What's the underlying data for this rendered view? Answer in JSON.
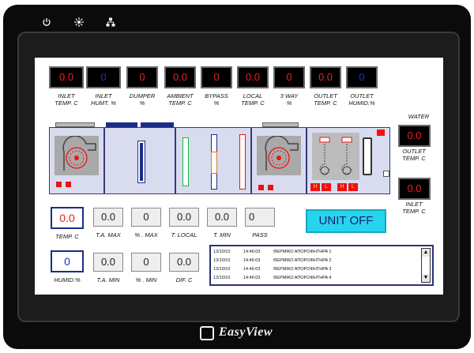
{
  "device": {
    "brand": "EasyView",
    "top_icons": [
      "power-icon",
      "brightness-icon",
      "network-icon"
    ]
  },
  "readouts": [
    {
      "value": "0.0",
      "label": "INLET\nTEMP. C",
      "color": "red"
    },
    {
      "value": "0",
      "label": "INLET\nHUMT. %",
      "color": "blue"
    },
    {
      "value": "0",
      "label": "DUMPER\n%",
      "color": "red"
    },
    {
      "value": "0.0",
      "label": "AMBIENT\nTEMP. C",
      "color": "red"
    },
    {
      "value": "0",
      "label": "BYPASS\n%",
      "color": "red"
    },
    {
      "value": "0.0",
      "label": "LOCAL\nTEMP. C",
      "color": "red"
    },
    {
      "value": "0",
      "label": "3 WAY\n%",
      "color": "red"
    },
    {
      "value": "0.0",
      "label": "OUTLET\nTEMP. C",
      "color": "red"
    },
    {
      "value": "0",
      "label": "OUTLET\nHUMID.%",
      "color": "blue"
    }
  ],
  "water": {
    "title": "WATER",
    "outlet": {
      "value": "0.0",
      "label": "OUTLET\nTEMP. C"
    },
    "inlet": {
      "value": "0.0",
      "label": "INLET\nTEMP. C"
    }
  },
  "ahu": {
    "heater_labels": [
      "H",
      "L",
      "H",
      "L"
    ]
  },
  "setpoints": {
    "temp": {
      "value": "0.0",
      "label": "TEMP. C"
    },
    "humid": {
      "value": "0",
      "label": "HUMID.%"
    },
    "row1": [
      {
        "value": "0.0",
        "label": "T.A. MAX"
      },
      {
        "value": "0",
        "label": "% . MAX"
      },
      {
        "value": "0.0",
        "label": "T. LOCAL"
      },
      {
        "value": "0.0",
        "label": "T. MIN"
      },
      {
        "value": "0",
        "label": "PASS"
      }
    ],
    "row2": [
      {
        "value": "0.0",
        "label": "T.A. MIN"
      },
      {
        "value": "0",
        "label": "% . MIN"
      },
      {
        "value": "0.0",
        "label": "DIF. C"
      }
    ]
  },
  "unit_button": {
    "label": "UNIT OFF",
    "color": "#27d4ee"
  },
  "alarms": [
    {
      "date": "13/10/10",
      "time": "14:46:03",
      "message": "ΘΕΡΜΙΚΟ ΑΠΟΡΟΦΗΤΗΡΑ 1"
    },
    {
      "date": "13/10/10",
      "time": "14:46:03",
      "message": "ΘΕΡΜΙΚΟ ΑΠΟΡΟΦΗΤΗΡΑ 2"
    },
    {
      "date": "13/10/10",
      "time": "14:46:03",
      "message": "ΘΕΡΜΙΚΟ ΑΠΟΡΟΦΗΤΗΡΑ 3"
    },
    {
      "date": "13/10/10",
      "time": "14:46:03",
      "message": "ΘΕΡΜΙΚΟ ΑΠΟΡΟΦΗΤΗΡΑ 4"
    }
  ],
  "colors": {
    "value_red": "#e52222",
    "value_blue": "#1638cc",
    "accent_navy": "#1a2d8a",
    "unit_off_cyan": "#27d4ee"
  }
}
